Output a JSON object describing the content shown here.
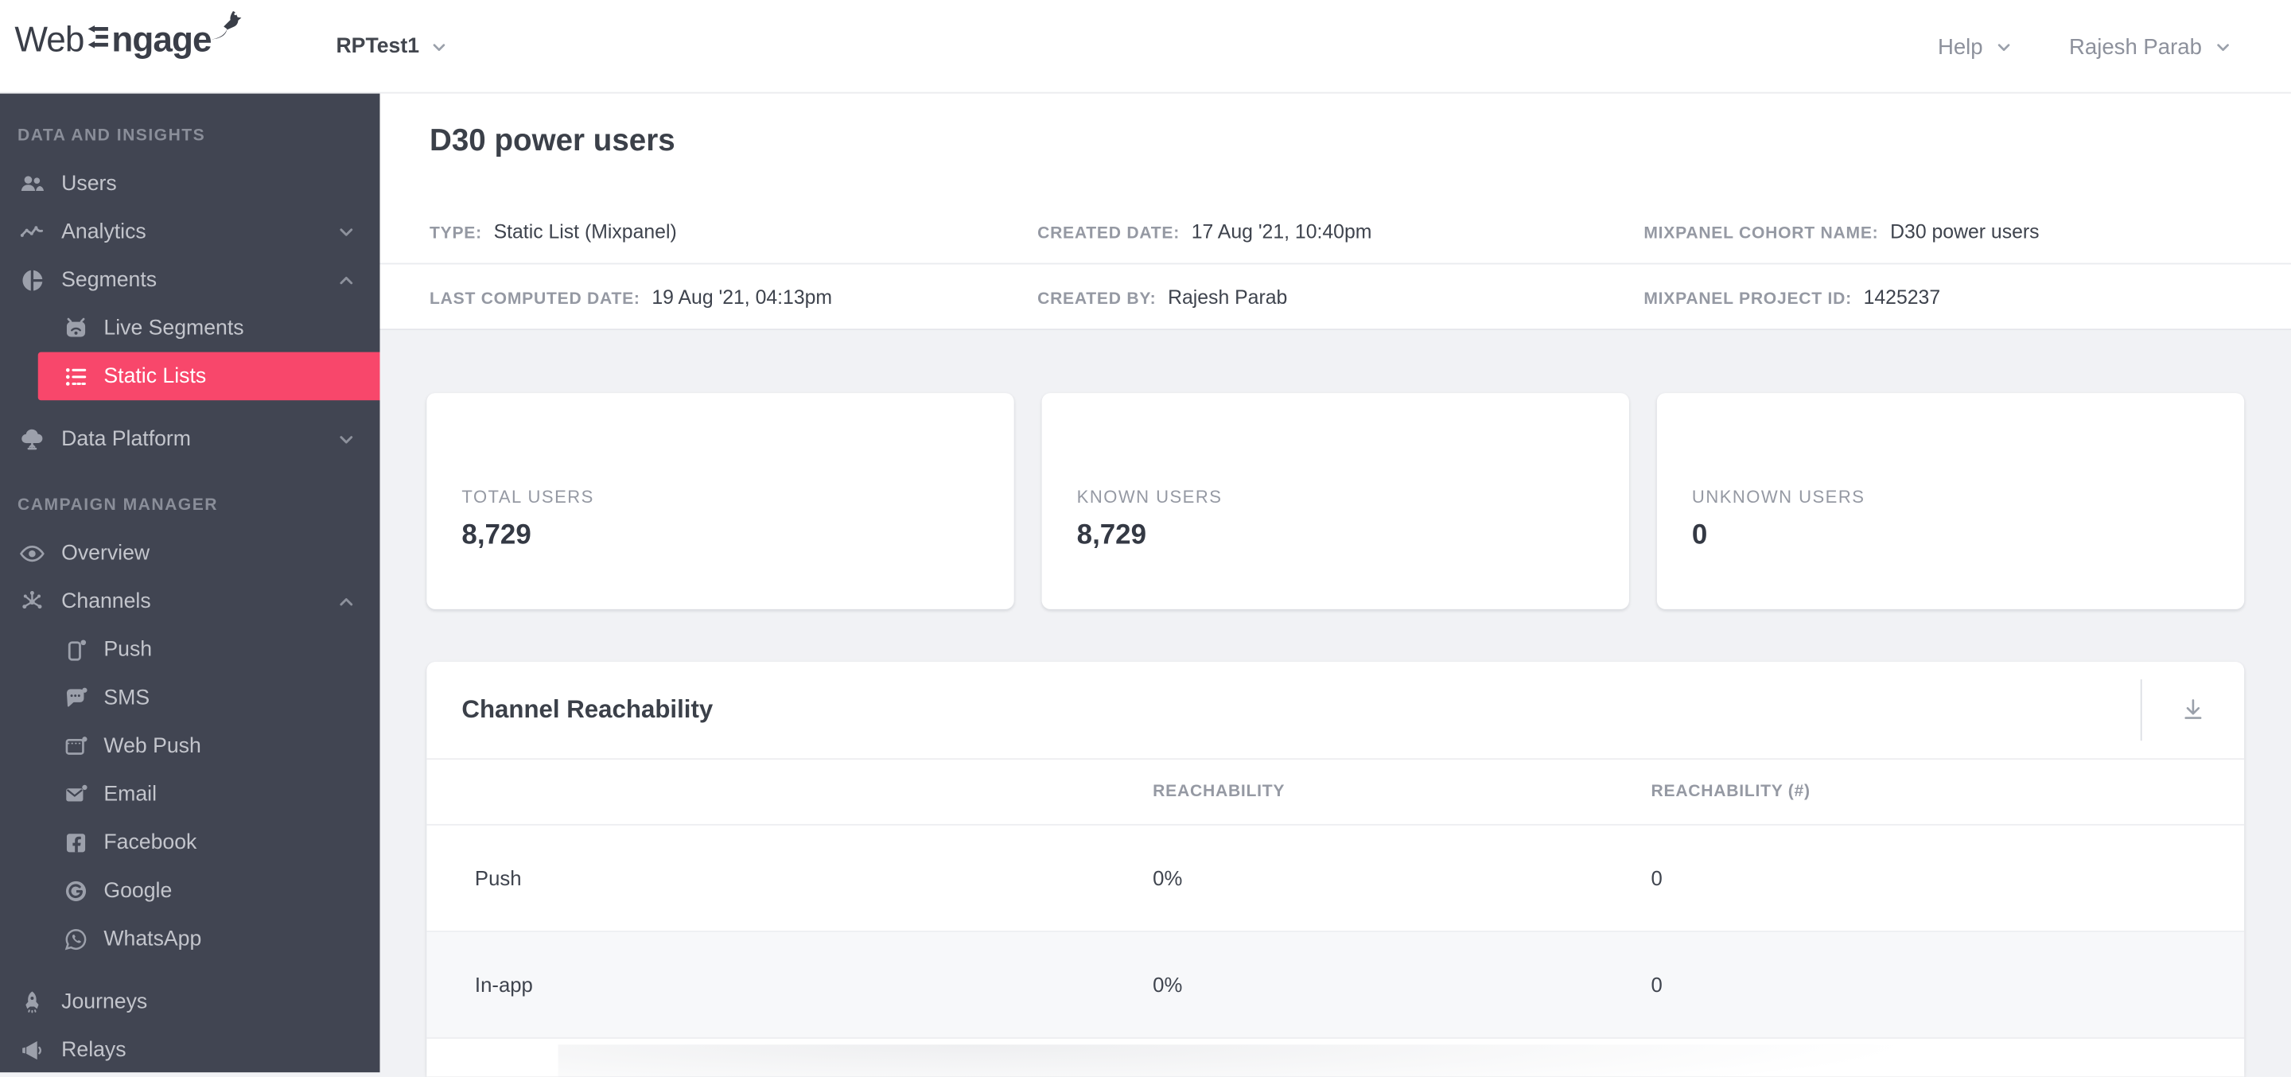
{
  "colors": {
    "accent": "#F8476B",
    "sidebar_bg": "#414552"
  },
  "header": {
    "logo_part1": "Web",
    "logo_part2": "ngage",
    "workspace": "RPTest1",
    "help_label": "Help",
    "user_name": "Rajesh Parab"
  },
  "sidebar": {
    "sections": [
      {
        "title": "DATA AND INSIGHTS",
        "items": [
          {
            "label": "Users",
            "icon": "users"
          },
          {
            "label": "Analytics",
            "icon": "analytics",
            "chevron": "down"
          },
          {
            "label": "Segments",
            "icon": "segments",
            "chevron": "up",
            "children": [
              {
                "label": "Live Segments",
                "icon": "live-segments"
              },
              {
                "label": "Static Lists",
                "icon": "static-lists",
                "active": true
              }
            ]
          },
          {
            "label": "Data Platform",
            "icon": "data-platform",
            "chevron": "down"
          }
        ]
      },
      {
        "title": "CAMPAIGN MANAGER",
        "items": [
          {
            "label": "Overview",
            "icon": "overview"
          },
          {
            "label": "Channels",
            "icon": "channels",
            "chevron": "up",
            "children": [
              {
                "label": "Push",
                "icon": "push"
              },
              {
                "label": "SMS",
                "icon": "sms"
              },
              {
                "label": "Web Push",
                "icon": "web-push"
              },
              {
                "label": "Email",
                "icon": "email"
              },
              {
                "label": "Facebook",
                "icon": "facebook"
              },
              {
                "label": "Google",
                "icon": "google"
              },
              {
                "label": "WhatsApp",
                "icon": "whatsapp"
              }
            ]
          },
          {
            "label": "Journeys",
            "icon": "journeys"
          },
          {
            "label": "Relays",
            "icon": "relays"
          }
        ]
      }
    ]
  },
  "page": {
    "title": "D30 power users",
    "meta": [
      {
        "label": "TYPE:",
        "value": "Static List (Mixpanel)"
      },
      {
        "label": "CREATED DATE:",
        "value": "17 Aug '21, 10:40pm"
      },
      {
        "label": "MIXPANEL COHORT NAME:",
        "value": "D30 power users"
      },
      {
        "label": "LAST COMPUTED DATE:",
        "value": "19 Aug '21, 04:13pm"
      },
      {
        "label": "CREATED BY:",
        "value": "Rajesh Parab"
      },
      {
        "label": "MIXPANEL PROJECT ID:",
        "value": "1425237"
      }
    ],
    "stats": [
      {
        "label": "TOTAL USERS",
        "value": "8,729"
      },
      {
        "label": "KNOWN USERS",
        "value": "8,729"
      },
      {
        "label": "UNKNOWN USERS",
        "value": "0"
      }
    ],
    "reachability": {
      "title": "Channel Reachability",
      "columns": [
        "REACHABILITY",
        "REACHABILITY (#)"
      ],
      "rows": [
        {
          "channel": "Push",
          "reachability": "0%",
          "count": "0"
        },
        {
          "channel": "In-app",
          "reachability": "0%",
          "count": "0"
        }
      ]
    }
  }
}
